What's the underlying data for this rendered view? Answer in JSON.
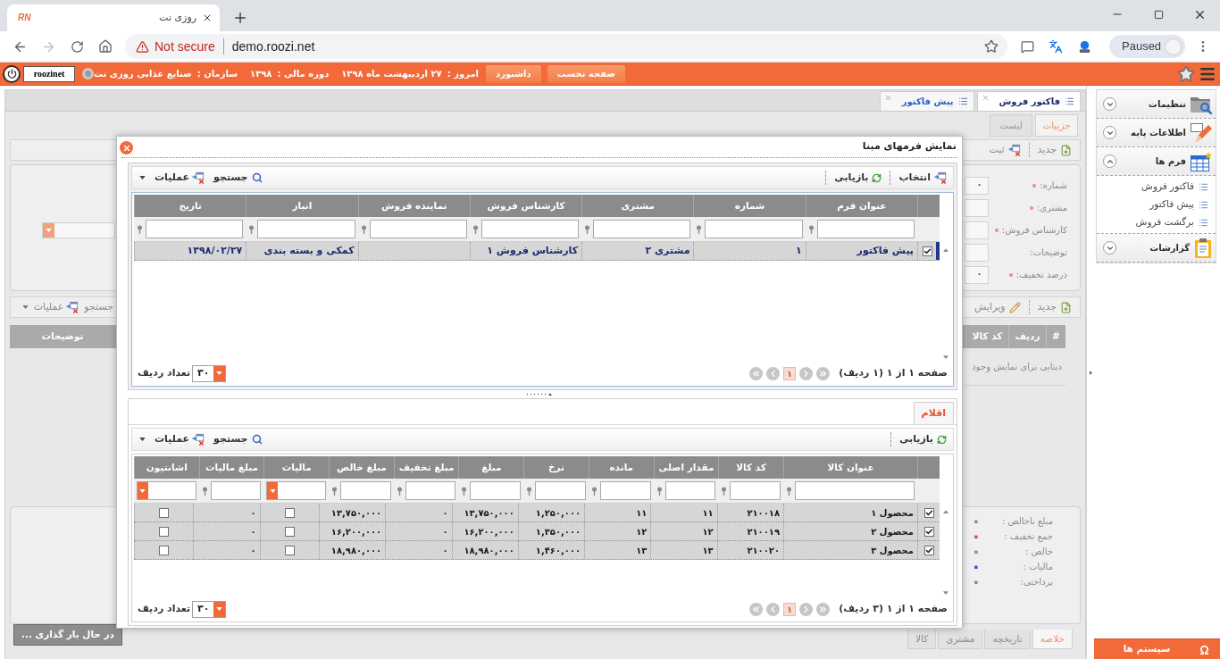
{
  "browser": {
    "tab": {
      "favicon": "RN",
      "title": "روزی نت"
    },
    "security": "Not secure",
    "url": "demo.roozi.net",
    "profile": "Paused"
  },
  "header": {
    "nav": [
      {
        "label": "صفحه نخست"
      },
      {
        "label": "داشبورد"
      }
    ],
    "info": [
      {
        "label": "امروز :",
        "value": "۲۷ اردیبهشت ماه ۱۳۹۸"
      },
      {
        "label": "دوره مالی :",
        "value": "۱۳۹۸"
      },
      {
        "label": "سازمان :",
        "value": "صنایع غذایی روزی نت"
      }
    ],
    "username": "roozinet"
  },
  "sidebar": {
    "groups": [
      {
        "label": "تنظیمات",
        "kind": "settings",
        "expanded": false
      },
      {
        "label": "اطلاعات پایه",
        "kind": "base",
        "expanded": false
      },
      {
        "label": "فرم ها",
        "kind": "forms",
        "expanded": true,
        "children": [
          {
            "label": "فاکتور فروش"
          },
          {
            "label": "پیش فاکتور"
          },
          {
            "label": "برگشت فروش"
          }
        ]
      },
      {
        "label": "گزارشات",
        "kind": "reports",
        "expanded": false
      }
    ],
    "systems_button": "سیستم ها"
  },
  "invoice": {
    "tabs": [
      {
        "label": "فاکتور فروش",
        "selected": true
      },
      {
        "label": "پیش فاکتور",
        "selected": false
      }
    ],
    "subtabs": [
      {
        "label": "جزییات",
        "selected": true
      },
      {
        "label": "لیست",
        "selected": false
      }
    ],
    "toolbar": [
      {
        "label": "جدید",
        "kind": "new"
      },
      {
        "label": "ثبت",
        "kind": "save"
      }
    ],
    "fields": [
      {
        "label": "شماره:",
        "required": true,
        "kind": "text",
        "value": "۰"
      },
      {
        "label": "مشتری:",
        "required": true,
        "kind": "text"
      },
      {
        "label": "کارشناس فروش:",
        "required": true,
        "kind": "select"
      },
      {
        "label": "توضیحات:",
        "required": false,
        "kind": "text"
      },
      {
        "label": "درصد تخفیف:",
        "required": true,
        "kind": "text",
        "value": "۰"
      }
    ],
    "items_toolbar": {
      "buttons": [
        {
          "label": "جدید",
          "kind": "new"
        },
        {
          "label": "ویرایش",
          "kind": "edit"
        }
      ],
      "search": "جستجو",
      "actions": "عملیات"
    },
    "items_grid": {
      "columns": [
        {
          "label": "#"
        },
        {
          "label": "ردیف"
        },
        {
          "label": "کد کالا"
        },
        {
          "label": "توضیحات"
        }
      ],
      "empty_message": "دیتایی برای نمایش وجود"
    },
    "summary": [
      {
        "label": "مبلغ ناخالص :",
        "value": "۰",
        "color": "#8c8c8c"
      },
      {
        "label": "جمع تخفیف :",
        "value": "۰",
        "color": "#e34b4b"
      },
      {
        "label": "خالص :",
        "value": "۰",
        "color": "#8c8c8c"
      },
      {
        "label": "مالیات :",
        "value": "۰",
        "color": "#4b4bd8"
      },
      {
        "label": "پرداختی:",
        "value": "۰",
        "color": "#8c8c8c"
      }
    ],
    "bottom_tabs": [
      {
        "label": "خلاصه",
        "selected": true
      },
      {
        "label": "تاریخچه",
        "selected": false
      },
      {
        "label": "مشتری",
        "selected": false
      },
      {
        "label": "کالا",
        "selected": false
      }
    ]
  },
  "loading": "در حال بار گذاری ...",
  "modal": {
    "title": "نمایش فرمهای مبنا",
    "forms_panel": {
      "toolbar": {
        "buttons": [
          {
            "label": "انتخاب",
            "kind": "pick"
          },
          {
            "label": "بازیابی",
            "kind": "refresh"
          }
        ],
        "search": "جستجو",
        "actions": "عملیات"
      },
      "columns": [
        {
          "label": "عنوان فرم",
          "filter_dropdown": false
        },
        {
          "label": "شماره",
          "filter_dropdown": false
        },
        {
          "label": "مشتری",
          "filter_dropdown": false
        },
        {
          "label": "کارشناس فروش",
          "filter_dropdown": false
        },
        {
          "label": "نماینده فروش",
          "filter_dropdown": false
        },
        {
          "label": "انبار",
          "filter_dropdown": false
        },
        {
          "label": "تاریخ",
          "filter_dropdown": false
        }
      ],
      "rows": [
        {
          "checked": true,
          "current": true,
          "cells": [
            {
              "text": "پیش فاکتور"
            },
            {
              "text": "۱"
            },
            {
              "text": "مشتری ۲"
            },
            {
              "text": "کارشناس فروش ۱"
            },
            {},
            {
              "text": "کمکی و بسته بندی"
            },
            {
              "text": "۱۳۹۸/۰۲/۲۷"
            }
          ]
        }
      ],
      "pager": {
        "summary": "صفحه ۱ از ۱ (۱ ردیف)",
        "page": "۱"
      },
      "page_size": {
        "value": "۳۰",
        "label": "تعداد ردیف"
      }
    },
    "items_panel": {
      "tabs": [
        {
          "label": "اقلام",
          "selected": true
        }
      ],
      "toolbar": {
        "buttons": [
          {
            "label": "بازیابی",
            "kind": "refresh"
          }
        ],
        "search": "جستجو",
        "actions": "عملیات"
      },
      "columns": [
        {
          "label": "عنوان کالا",
          "kind": "text",
          "filter_dropdown": false
        },
        {
          "label": "کد کالا",
          "kind": "text",
          "filter_dropdown": false
        },
        {
          "label": "مقدار اصلی",
          "kind": "text",
          "filter_dropdown": false
        },
        {
          "label": "مانده",
          "kind": "text",
          "filter_dropdown": false
        },
        {
          "label": "نرخ",
          "kind": "text",
          "filter_dropdown": false
        },
        {
          "label": "مبلغ",
          "kind": "text",
          "filter_dropdown": false
        },
        {
          "label": "مبلغ تخفیف",
          "kind": "text",
          "filter_dropdown": false
        },
        {
          "label": "مبلغ خالص",
          "kind": "text",
          "filter_dropdown": false
        },
        {
          "label": "مالیات",
          "kind": "check",
          "filter_dropdown": true
        },
        {
          "label": "مبلغ مالیات",
          "kind": "text",
          "filter_dropdown": false
        },
        {
          "label": "اشانتیون",
          "kind": "check",
          "filter_dropdown": true
        }
      ],
      "rows": [
        {
          "checked": true,
          "current": false,
          "cells": [
            {
              "text": "محصول ۱"
            },
            {
              "text": "۲۱۰۰۱۸"
            },
            {
              "text": "۱۱"
            },
            {
              "text": "۱۱"
            },
            {
              "text": "۱,۲۵۰,۰۰۰"
            },
            {
              "text": "۱۳,۷۵۰,۰۰۰"
            },
            {
              "text": "۰"
            },
            {
              "text": "۱۳,۷۵۰,۰۰۰"
            },
            {
              "checked": false
            },
            {
              "text": "۰"
            },
            {
              "checked": false
            }
          ]
        },
        {
          "checked": true,
          "current": false,
          "cells": [
            {
              "text": "محصول ۲"
            },
            {
              "text": "۲۱۰۰۱۹"
            },
            {
              "text": "۱۲"
            },
            {
              "text": "۱۲"
            },
            {
              "text": "۱,۳۵۰,۰۰۰"
            },
            {
              "text": "۱۶,۲۰۰,۰۰۰"
            },
            {
              "text": "۰"
            },
            {
              "text": "۱۶,۲۰۰,۰۰۰"
            },
            {
              "checked": false
            },
            {
              "text": "۰"
            },
            {
              "checked": false
            }
          ]
        },
        {
          "checked": true,
          "current": false,
          "cells": [
            {
              "text": "محصول ۳"
            },
            {
              "text": "۲۱۰۰۲۰"
            },
            {
              "text": "۱۳"
            },
            {
              "text": "۱۳"
            },
            {
              "text": "۱,۴۶۰,۰۰۰"
            },
            {
              "text": "۱۸,۹۸۰,۰۰۰"
            },
            {
              "text": "۰"
            },
            {
              "text": "۱۸,۹۸۰,۰۰۰"
            },
            {
              "checked": false
            },
            {
              "text": "۰"
            },
            {
              "checked": false
            }
          ]
        }
      ],
      "pager": {
        "summary": "صفحه ۱ از ۱ (۳ ردیف)",
        "page": "۱"
      },
      "page_size": {
        "value": "۳۰",
        "label": "تعداد ردیف"
      }
    }
  }
}
